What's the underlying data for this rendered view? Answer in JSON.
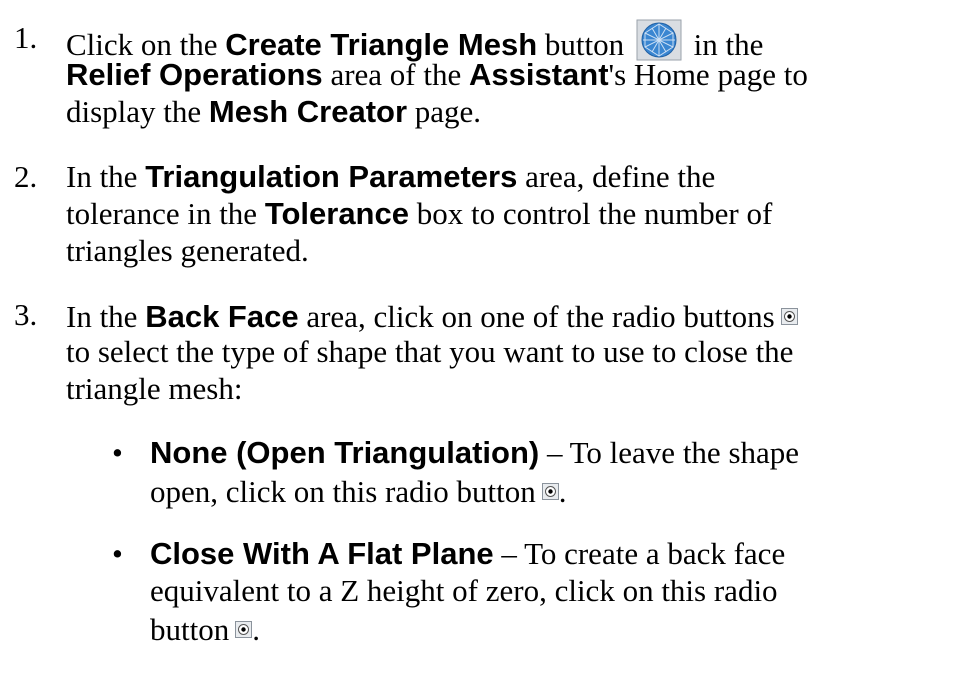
{
  "steps": [
    {
      "number": "1.",
      "lines": [
        [
          "Click on the ",
          "Create Triangle Mesh",
          " button ",
          "[mesh-icon]",
          " in the"
        ],
        [
          "Relief Operations",
          " area of the ",
          "Assistant",
          "'s Home page to"
        ],
        [
          "display the ",
          "Mesh Creator",
          " page."
        ]
      ]
    },
    {
      "number": "2.",
      "lines": [
        [
          "In the ",
          "Triangulation Parameters",
          " area, define the"
        ],
        [
          "tolerance in the ",
          "Tolerance",
          " box to control the number of"
        ],
        [
          "triangles generated."
        ]
      ]
    },
    {
      "number": "3.",
      "lines": [
        [
          "In the ",
          "Back Face",
          " area, click on one of the radio buttons"
        ],
        [
          "to select the type of shape that you want to use to close the"
        ],
        [
          "triangle mesh:"
        ]
      ]
    }
  ],
  "bullets": [
    {
      "symbol": "•",
      "lines": [
        [
          "None (Open Triangulation)",
          " – To leave the shape"
        ],
        [
          "open, click on this radio button",
          "."
        ]
      ]
    },
    {
      "symbol": "•",
      "lines": [
        [
          "Close With A Flat Plane",
          " – To create a back face"
        ],
        [
          "equivalent to a Z height of zero, click on this radio"
        ],
        [
          "button",
          "."
        ]
      ]
    }
  ],
  "icons": {
    "mesh": "mesh-icon",
    "radio": "radio-button-icon"
  }
}
